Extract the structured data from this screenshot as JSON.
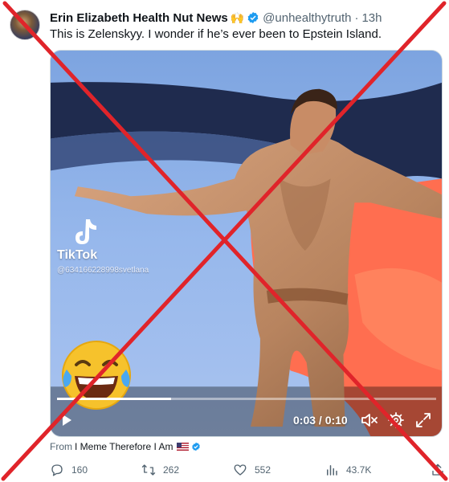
{
  "post": {
    "display_name": "Erin Elizabeth Health Nut News",
    "name_emoji": "🙌",
    "handle": "@unhealthytruth",
    "separator": "·",
    "time": "13h",
    "text": "This is Zelenskyy. I wonder if he’s ever been to Epstein Island."
  },
  "video": {
    "watermark_brand": "TikTok",
    "watermark_handle": "@634166228998svetlana",
    "time_readout": "0:03 / 0:10",
    "progress": 0.3,
    "overlay_emoji": "face-with-tears-of-joy"
  },
  "attribution": {
    "prefix": "From",
    "source": "I Meme Therefore I Am",
    "flag": "us-flag"
  },
  "metrics": {
    "replies": "160",
    "retweets": "262",
    "likes": "552",
    "views": "43.7K"
  },
  "colors": {
    "cross": "#e0242a",
    "verified": "#1d9bf0",
    "muted_text": "#536471"
  }
}
